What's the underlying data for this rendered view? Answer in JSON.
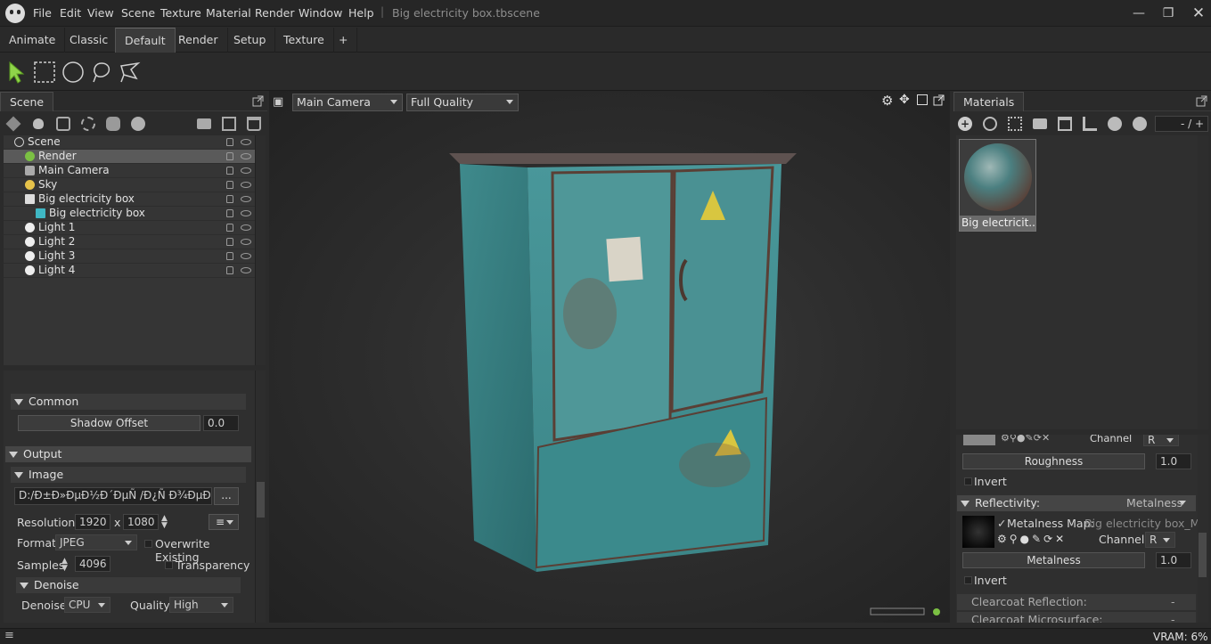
{
  "window": {
    "menu": [
      "File",
      "Edit",
      "View",
      "Scene",
      "Texture",
      "Material",
      "Render",
      "Window",
      "Help"
    ],
    "document_title": "Big electricity box.tbscene",
    "separator": "|"
  },
  "tabs": [
    "Animate",
    "Classic",
    "Default",
    "Render",
    "Setup",
    "Texture",
    "+"
  ],
  "active_tab": "Default",
  "scene_panel": {
    "title": "Scene",
    "tree": [
      {
        "label": "Scene",
        "indent": 0,
        "icon": "scene-icon"
      },
      {
        "label": "Render",
        "indent": 1,
        "icon": "render-gear-icon",
        "selected": true
      },
      {
        "label": "Main Camera",
        "indent": 1,
        "icon": "camera-icon"
      },
      {
        "label": "Sky",
        "indent": 1,
        "icon": "sky-icon"
      },
      {
        "label": "Big electricity box",
        "indent": 1,
        "icon": "mesh-file-icon"
      },
      {
        "label": "Big electricity box",
        "indent": 2,
        "icon": "cube-icon"
      },
      {
        "label": "Light 1",
        "indent": 1,
        "icon": "light-bulb-icon"
      },
      {
        "label": "Light 2",
        "indent": 1,
        "icon": "light-bulb-icon"
      },
      {
        "label": "Light 3",
        "indent": 1,
        "icon": "light-bulb-icon"
      },
      {
        "label": "Light 4",
        "indent": 1,
        "icon": "light-bulb-icon"
      }
    ]
  },
  "properties": {
    "common": "Common",
    "shadow_offset_label": "Shadow Offset",
    "shadow_offset_value": "0.0",
    "output": "Output",
    "image": "Image",
    "path": "D:/Ð±Ð»ÐµÐ½Ð´ÐµÑ /Ð¿Ñ Ð¾ÐµÐºÑ",
    "browse": "...",
    "resolution_label": "Resolution:",
    "res_w": "1920",
    "res_x": "x",
    "res_h": "1080",
    "format_label": "Format",
    "format_value": "JPEG",
    "overwrite_label": "Overwrite Existing",
    "samples_label": "Samples",
    "samples_value": "4096",
    "transparency_label": "Transparency",
    "denoise_section": "Denoise",
    "denoise_label": "Denoise",
    "denoise_value": "CPU",
    "quality_label": "Quality",
    "quality_value": "High"
  },
  "viewport": {
    "camera": "Main Camera",
    "quality": "Full Quality"
  },
  "materials": {
    "title": "Materials",
    "counter": "- / +",
    "thumb_label": "Big electricit...",
    "roughness_label": "Roughness",
    "roughness_value": "1.0",
    "invert": "Invert",
    "reflectivity_label": "Reflectivity:",
    "reflectivity_mode": "Metalness",
    "metal_map_label": "Metalness Map:",
    "metal_map_value": "Big electricity box_Meta",
    "channel_label": "Channel",
    "channel_value": "R",
    "channel_top": "Channel",
    "channel_top_value": "R",
    "metalness_label": "Metalness",
    "metalness_value": "1.0",
    "invert2": "Invert",
    "clearcoat_reflection": "Clearcoat Reflection:",
    "clearcoat_microsurface": "Clearcoat Microsurface:",
    "dash": "-"
  },
  "status": {
    "vram": "VRAM: 6%"
  },
  "colors": {
    "cabinet": "#3f8c8e",
    "rust": "#6a4a3c",
    "selected_row": "#5a5a5a"
  }
}
